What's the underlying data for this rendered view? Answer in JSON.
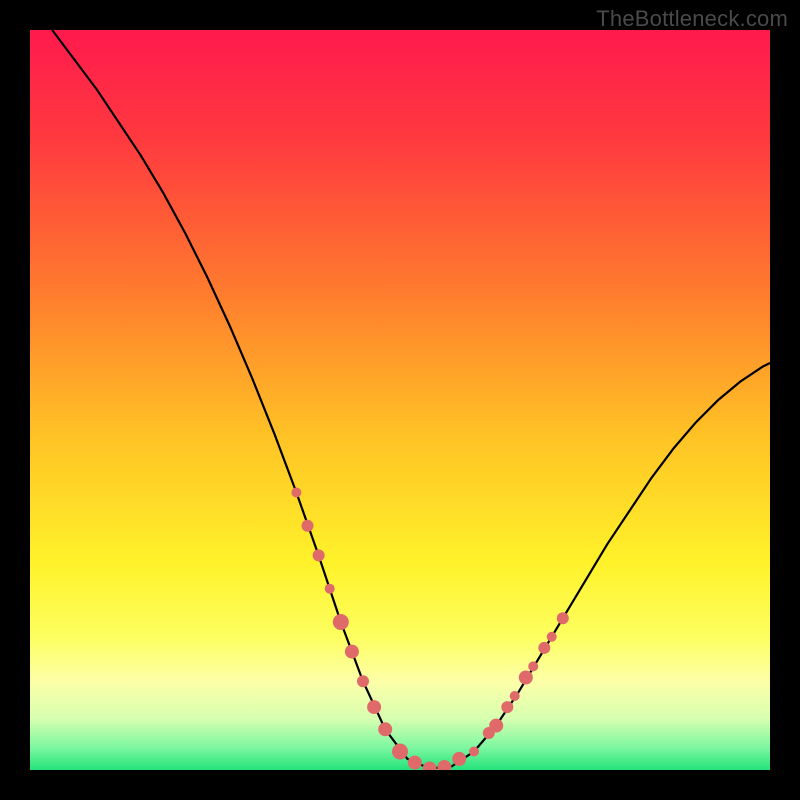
{
  "watermark": "TheBottleneck.com",
  "chart_data": {
    "type": "line",
    "title": "",
    "xlabel": "",
    "ylabel": "",
    "xlim": [
      0,
      100
    ],
    "ylim": [
      0,
      100
    ],
    "background_gradient": {
      "stops": [
        {
          "offset": 0.0,
          "color": "#ff1a4d"
        },
        {
          "offset": 0.15,
          "color": "#ff3a3f"
        },
        {
          "offset": 0.35,
          "color": "#ff7a2e"
        },
        {
          "offset": 0.55,
          "color": "#ffc325"
        },
        {
          "offset": 0.72,
          "color": "#fff22a"
        },
        {
          "offset": 0.82,
          "color": "#fdff60"
        },
        {
          "offset": 0.88,
          "color": "#fdffa8"
        },
        {
          "offset": 0.93,
          "color": "#d8ffb0"
        },
        {
          "offset": 0.97,
          "color": "#7cf7a0"
        },
        {
          "offset": 1.0,
          "color": "#23e27a"
        }
      ]
    },
    "series": [
      {
        "name": "bottleneck-curve",
        "color": "#000000",
        "x": [
          3,
          6,
          9,
          12,
          15,
          18,
          21,
          24,
          27,
          30,
          33,
          36,
          39,
          42,
          45,
          48,
          51,
          54,
          57,
          60,
          63,
          66,
          69,
          72,
          75,
          78,
          81,
          84,
          87,
          90,
          93,
          96,
          99,
          100
        ],
        "y": [
          100,
          96,
          92,
          87.5,
          83,
          78,
          72.5,
          66.5,
          60,
          53,
          45.5,
          37.5,
          29,
          20,
          12,
          5.5,
          1.5,
          0.2,
          0.5,
          2.5,
          6,
          10.5,
          15.5,
          20.5,
          25.5,
          30.5,
          35,
          39.5,
          43.5,
          47,
          50,
          52.5,
          54.5,
          55
        ]
      }
    ],
    "markers": {
      "name": "observed-points",
      "color": "#e06a6a",
      "radius_small": 5,
      "radius_large": 8,
      "points": [
        {
          "x": 36,
          "y": 37.5,
          "r": 5
        },
        {
          "x": 37.5,
          "y": 33,
          "r": 6
        },
        {
          "x": 39,
          "y": 29,
          "r": 6
        },
        {
          "x": 40.5,
          "y": 24.5,
          "r": 5
        },
        {
          "x": 42,
          "y": 20,
          "r": 8
        },
        {
          "x": 43.5,
          "y": 16,
          "r": 7
        },
        {
          "x": 45,
          "y": 12,
          "r": 6
        },
        {
          "x": 46.5,
          "y": 8.5,
          "r": 7
        },
        {
          "x": 48,
          "y": 5.5,
          "r": 7
        },
        {
          "x": 50,
          "y": 2.5,
          "r": 8
        },
        {
          "x": 52,
          "y": 1,
          "r": 7
        },
        {
          "x": 54,
          "y": 0.2,
          "r": 7
        },
        {
          "x": 56,
          "y": 0.4,
          "r": 7
        },
        {
          "x": 58,
          "y": 1.5,
          "r": 7
        },
        {
          "x": 60,
          "y": 2.5,
          "r": 5
        },
        {
          "x": 62,
          "y": 5,
          "r": 6
        },
        {
          "x": 63,
          "y": 6,
          "r": 7
        },
        {
          "x": 64.5,
          "y": 8.5,
          "r": 6
        },
        {
          "x": 65.5,
          "y": 10,
          "r": 5
        },
        {
          "x": 67,
          "y": 12.5,
          "r": 7
        },
        {
          "x": 68,
          "y": 14,
          "r": 5
        },
        {
          "x": 69.5,
          "y": 16.5,
          "r": 6
        },
        {
          "x": 70.5,
          "y": 18,
          "r": 5
        },
        {
          "x": 72,
          "y": 20.5,
          "r": 6
        }
      ]
    }
  }
}
